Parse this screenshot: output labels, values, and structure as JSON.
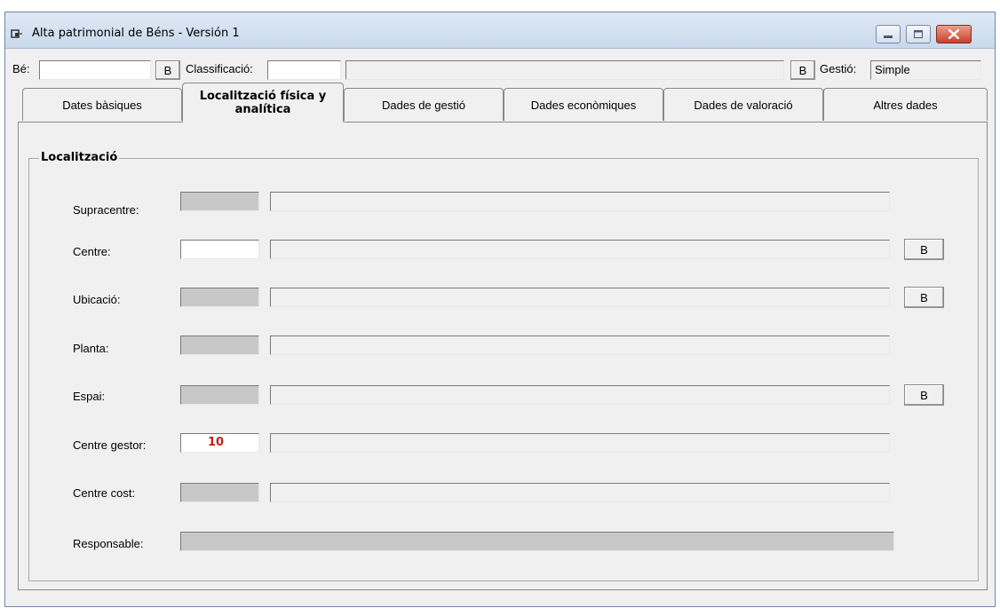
{
  "window": {
    "title": "Alta patrimonial de Béns - Versión 1"
  },
  "topbar": {
    "be_label": "Bé:",
    "be_value": "",
    "be_button": "B",
    "classificacio_label": "Classificació:",
    "classificacio_code": "",
    "classificacio_desc": "",
    "classificacio_button": "B",
    "gestio_label": "Gestió:",
    "gestio_value": "Simple"
  },
  "tabs": [
    {
      "label": "Dates bàsiques"
    },
    {
      "label": "Localització física y analítica"
    },
    {
      "label": "Dades de gestió"
    },
    {
      "label": "Dades econòmiques"
    },
    {
      "label": "Dades de valoració"
    },
    {
      "label": "Altres dades"
    }
  ],
  "active_tab": "Localització física y analítica",
  "localitzacio": {
    "group_title": "Localització",
    "rows": [
      {
        "label": "Supracentre:",
        "code": "",
        "desc": "",
        "button": ""
      },
      {
        "label": "Centre:",
        "code": "",
        "desc": "",
        "button": "B"
      },
      {
        "label": "Ubicació:",
        "code": "",
        "desc": "",
        "button": "B"
      },
      {
        "label": "Planta:",
        "code": "",
        "desc": "",
        "button": ""
      },
      {
        "label": "Espai:",
        "code": "",
        "desc": "",
        "button": "B"
      },
      {
        "label": "Centre gestor:",
        "code": "10",
        "desc": "",
        "button": ""
      },
      {
        "label": "Centre cost:",
        "code": "",
        "desc": "",
        "button": ""
      },
      {
        "label": "Responsable:",
        "code": "",
        "desc": "",
        "button": ""
      }
    ]
  },
  "colors": {
    "disabled_field": "#c8c8c8",
    "highlight_value": "#c0201a",
    "close_button": "#c6412b"
  }
}
